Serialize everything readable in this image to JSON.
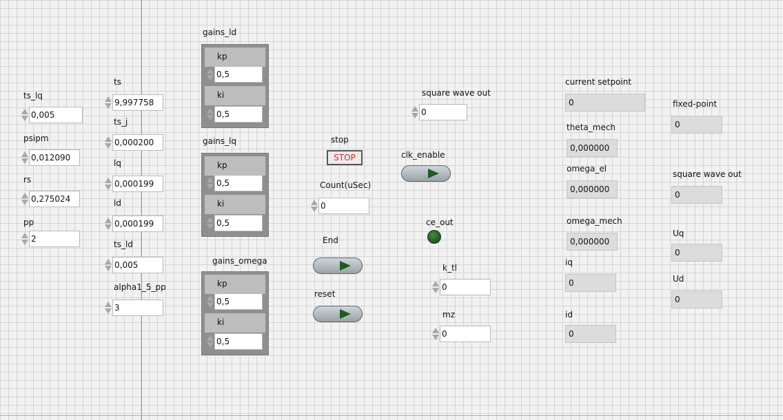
{
  "controls": {
    "ts_lq": {
      "label": "ts_lq",
      "value": "0,005"
    },
    "psipm": {
      "label": "psipm",
      "value": "0,012090"
    },
    "rs": {
      "label": "rs",
      "value": "0,275024"
    },
    "pp": {
      "label": "pp",
      "value": "2"
    },
    "ts": {
      "label": "ts",
      "value": "9,997758"
    },
    "ts_j": {
      "label": "ts_j",
      "value": "0,000200"
    },
    "lq": {
      "label": "lq",
      "value": "0,000199"
    },
    "ld": {
      "label": "ld",
      "value": "0,000199"
    },
    "ts_ld": {
      "label": "ts_ld",
      "value": "0,005"
    },
    "alpha": {
      "label": "alpha1_5_pp",
      "value": "3"
    },
    "count": {
      "label": "Count(uSec)",
      "value": "0"
    },
    "sqw_in": {
      "label": "square wave out",
      "value": "0"
    },
    "k_tl": {
      "label": "k_tl",
      "value": "0"
    },
    "mz": {
      "label": "mz",
      "value": "0"
    }
  },
  "clusters": {
    "gains_ld": {
      "label": "gains_ld",
      "kp_label": "kp",
      "kp": "0,5",
      "ki_label": "ki",
      "ki": "0,5"
    },
    "gains_lq": {
      "label": "gains_lq",
      "kp_label": "kp",
      "kp": "0,5",
      "ki_label": "ki",
      "ki": "0,5"
    },
    "gains_omega": {
      "label": "gains_omega",
      "kp_label": "kp",
      "kp": "0,5",
      "ki_label": "ki",
      "ki": "0,5"
    }
  },
  "buttons": {
    "stop": {
      "label": "stop",
      "text": "STOP"
    },
    "end": {
      "label": "End"
    },
    "reset": {
      "label": "reset"
    },
    "clk_enable": {
      "label": "clk_enable"
    },
    "ce_out": {
      "label": "ce_out"
    }
  },
  "indicators": {
    "current_setpoint": {
      "label": "current setpoint",
      "value": "0"
    },
    "theta_mech": {
      "label": "theta_mech",
      "value": "0,000000"
    },
    "omega_el": {
      "label": "omega_el",
      "value": "0,000000"
    },
    "omega_mech": {
      "label": "omega_mech",
      "value": "0,000000"
    },
    "iq": {
      "label": "iq",
      "value": "0"
    },
    "id": {
      "label": "id",
      "value": "0"
    },
    "fixed_point": {
      "label": "fixed-point",
      "value": "0"
    },
    "sqw_out": {
      "label": "square wave out",
      "value": "0"
    },
    "uq": {
      "label": "Uq",
      "value": "0"
    },
    "ud": {
      "label": "Ud",
      "value": "0"
    }
  },
  "colors": {
    "led_off": "#1a5a1a",
    "stop_text": "#e02020",
    "cluster_bg": "#8f8f8f"
  }
}
